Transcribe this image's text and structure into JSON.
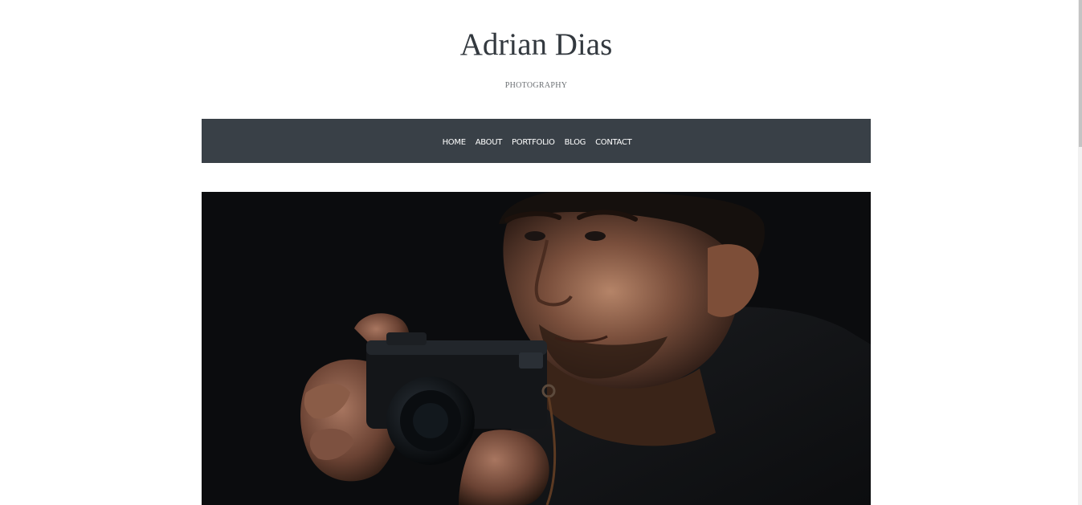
{
  "header": {
    "site_title": "Adrian Dias",
    "tagline": "PHOTOGRAPHY"
  },
  "nav": {
    "items": [
      {
        "label": "HOME"
      },
      {
        "label": "ABOUT"
      },
      {
        "label": "PORTFOLIO"
      },
      {
        "label": "BLOG"
      },
      {
        "label": "CONTACT"
      }
    ]
  },
  "hero": {
    "subject": "man-holding-camera-photo"
  },
  "colors": {
    "nav_background": "#394047",
    "title_text": "#33393f",
    "hero_background": "#0b0c0e"
  }
}
